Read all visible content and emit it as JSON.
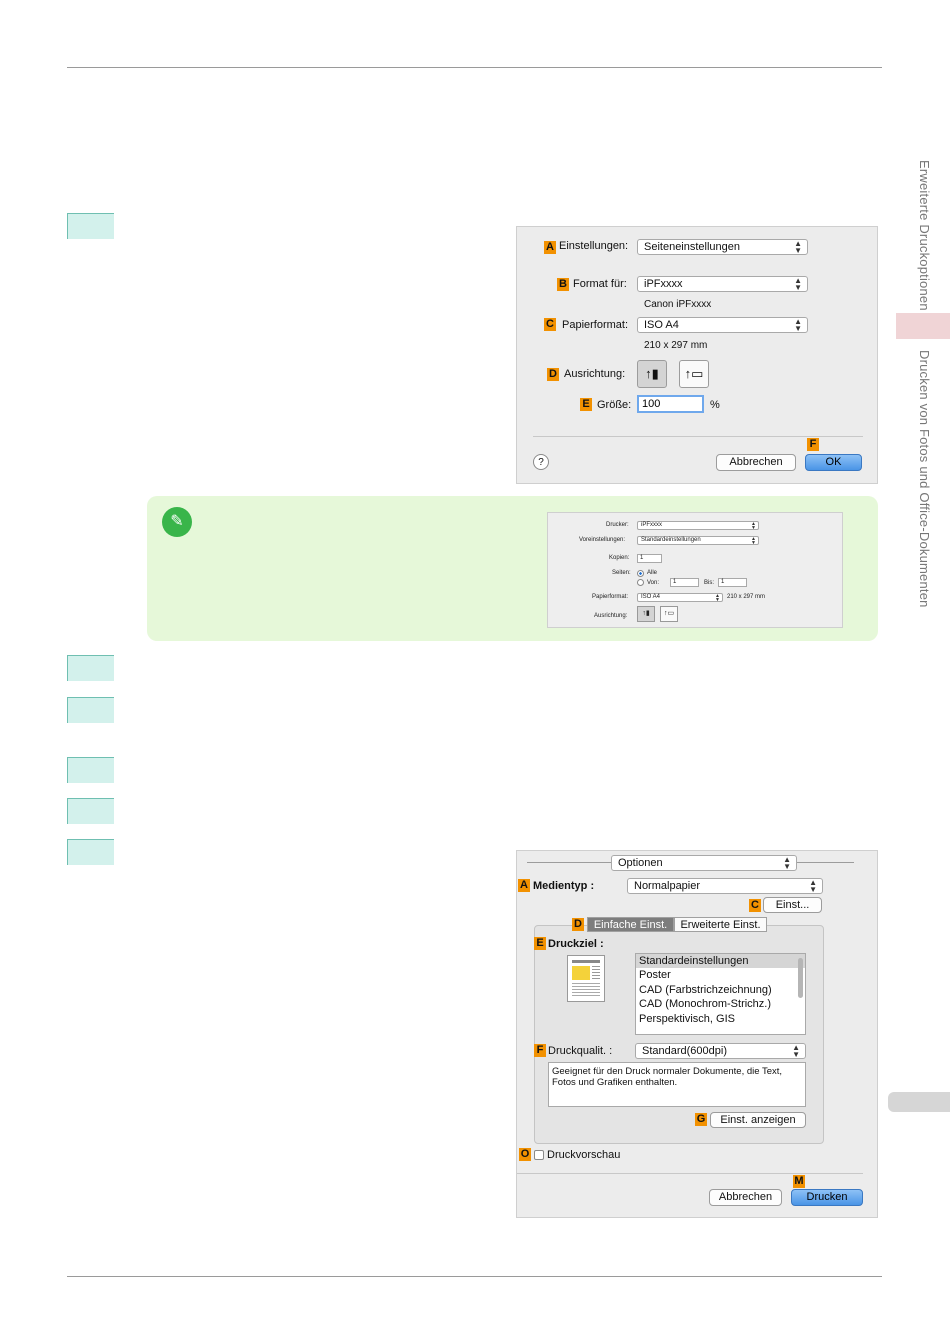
{
  "sidebar": {
    "section_top": "Erweiterte Druckoptionen",
    "section_bottom": "Drucken von Fotos und Office-Dokumenten"
  },
  "dialog1": {
    "einstellungen_label": "Einstellungen:",
    "einstellungen_value": "Seiteneinstellungen",
    "format_label": "Format für:",
    "format_value": "iPFxxxx",
    "format_sub": "Canon iPFxxxx",
    "papier_label": "Papierformat:",
    "papier_value": "ISO A4",
    "papier_sub": "210 x 297 mm",
    "ausrichtung_label": "Ausrichtung:",
    "groesse_label": "Größe:",
    "groesse_value": "100",
    "groesse_unit": "%",
    "help": "?",
    "cancel": "Abbrechen",
    "ok": "OK",
    "badges": {
      "a": "A",
      "b": "B",
      "c": "C",
      "d": "D",
      "e": "E",
      "f": "F"
    }
  },
  "note": {
    "icon": "pencil-icon",
    "drucker_label": "Drucker:",
    "drucker_value": "iPFxxxx",
    "vorein_label": "Voreinstellungen:",
    "vorein_value": "Standardeinstellungen",
    "kopien_label": "Kopien:",
    "kopien_value": "1",
    "seiten_label": "Seiten:",
    "seiten_alle": "Alle",
    "seiten_von": "Von:",
    "von_value": "1",
    "bis_label": "Bis:",
    "bis_value": "1",
    "papier_label": "Papierformat:",
    "papier_value": "ISO A4",
    "papier_size": "210 x 297 mm",
    "ausrichtung_label": "Ausrichtung:"
  },
  "dialog2": {
    "optionen": "Optionen",
    "medientyp_label": "Medientyp :",
    "medientyp_value": "Normalpapier",
    "einst_btn": "Einst...",
    "tab_simple": "Einfache Einst.",
    "tab_advanced": "Erweiterte Einst.",
    "druckziel_label": "Druckziel :",
    "druckziel_items": [
      "Standardeinstellungen",
      "Poster",
      "CAD (Farbstrichzeichnung)",
      "CAD (Monochrom-Strichz.)",
      "Perspektivisch, GIS"
    ],
    "druckqual_label": "Druckqualit. :",
    "druckqual_value": "Standard(600dpi)",
    "description": "Geeignet für den Druck normaler Dokumente, die Text, Fotos und Grafiken enthalten.",
    "einst_anzeigen": "Einst. anzeigen",
    "druckvorschau": "Druckvorschau",
    "cancel": "Abbrechen",
    "print": "Drucken",
    "badges": {
      "a": "A",
      "c": "C",
      "d": "D",
      "e": "E",
      "f": "F",
      "g": "G",
      "o": "O",
      "m": "M"
    }
  }
}
